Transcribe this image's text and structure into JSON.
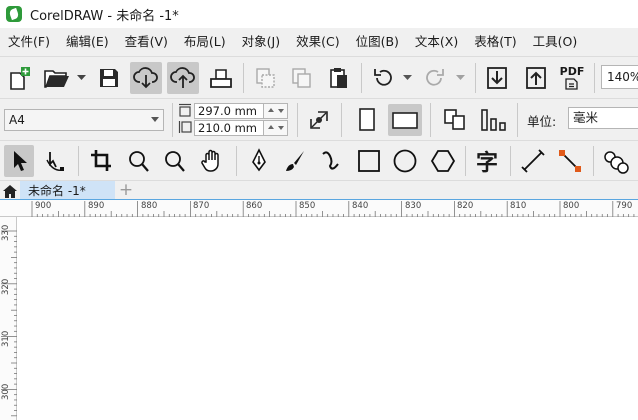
{
  "window": {
    "title": "CorelDRAW - 未命名 -1*"
  },
  "menu": [
    "文件(F)",
    "编辑(E)",
    "查看(V)",
    "布局(L)",
    "对象(J)",
    "效果(C)",
    "位图(B)",
    "文本(X)",
    "表格(T)",
    "工具(O)"
  ],
  "standard_toolbar": {
    "buttons": [
      "new-document",
      "open-document",
      "save",
      "download-from-cloud",
      "upload-to-cloud",
      "print",
      "cut",
      "copy",
      "paste",
      "undo",
      "redo",
      "import",
      "export",
      "publish-pdf"
    ],
    "pdf_label": "PDF",
    "zoom_level": "140%"
  },
  "property_bar": {
    "page_size": "A4",
    "page_width": "297.0 mm",
    "page_height": "210.0 mm",
    "units_label": "单位:",
    "units_value": "毫米"
  },
  "toolbox": [
    "pick-tool",
    "shape-tool",
    "crop-tool",
    "zoom-tool",
    "zoom-out-tool",
    "pan-tool",
    "pen-tool",
    "brush-tool",
    "curve-tool",
    "rectangle-tool",
    "ellipse-tool",
    "polygon-tool",
    "text-tool",
    "dimension-tool",
    "connector-tool",
    "blend-tool"
  ],
  "text_tool_glyph": "字",
  "tabs": {
    "document_tab": "未命名 -1*",
    "add_tab": "+"
  },
  "rulers": {
    "horizontal": [
      "900",
      "890",
      "880",
      "870",
      "860",
      "850",
      "840",
      "830",
      "820",
      "810",
      "800",
      "790"
    ],
    "vertical": [
      "330",
      "320",
      "310",
      "300"
    ]
  },
  "colors": {
    "app_logo": "#2e9a3a",
    "tab_active": "#cfe3f7",
    "ruler_marker": "#5aa6e0",
    "connector_accent": "#e05a1a"
  }
}
